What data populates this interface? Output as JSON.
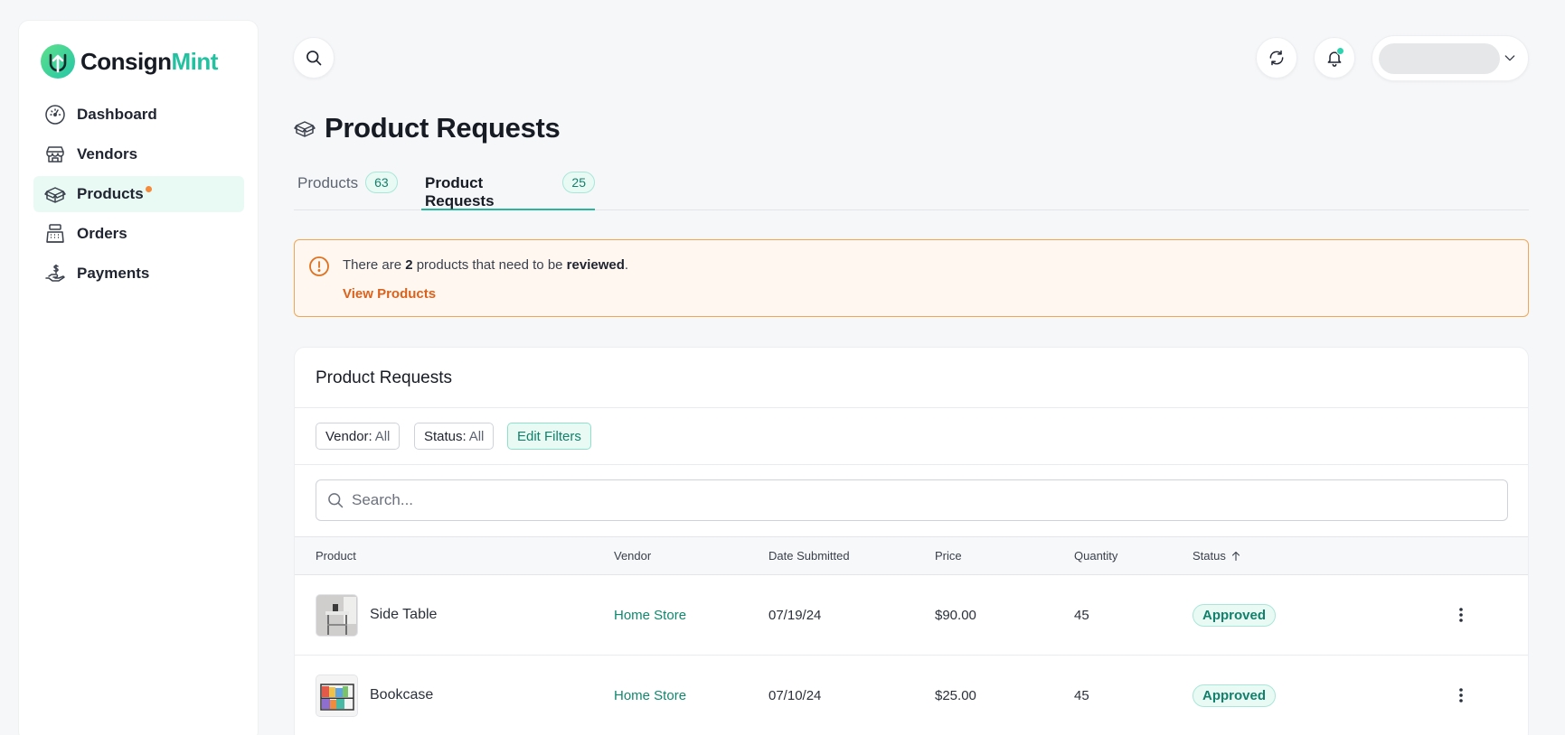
{
  "brand": {
    "name_dark": "Consign",
    "name_accent": "Mint",
    "accent_color": "#22c1a0"
  },
  "sidebar": {
    "items": [
      {
        "label": "Dashboard",
        "icon": "dashboard-icon",
        "active": false
      },
      {
        "label": "Vendors",
        "icon": "store-icon",
        "active": false
      },
      {
        "label": "Products",
        "icon": "box-icon",
        "active": true,
        "has_dot": true
      },
      {
        "label": "Orders",
        "icon": "register-icon",
        "active": false
      },
      {
        "label": "Payments",
        "icon": "payment-hand-icon",
        "active": false
      }
    ]
  },
  "header": {
    "title": "Product Requests",
    "title_icon": "box-icon"
  },
  "tabs": [
    {
      "label": "Products",
      "count": "63",
      "active": false
    },
    {
      "label": "Product Requests",
      "count": "25",
      "active": true
    }
  ],
  "alert": {
    "text_1": "There are ",
    "count": "2",
    "text_2": " products that need to be ",
    "emphasis": "reviewed",
    "text_3": ".",
    "link": "View Products"
  },
  "card": {
    "title": "Product Requests",
    "filters": {
      "vendor_key": "Vendor:",
      "vendor_value": "All",
      "status_key": "Status:",
      "status_value": "All",
      "edit_label": "Edit Filters"
    },
    "search_placeholder": "Search...",
    "columns": [
      "Product",
      "Vendor",
      "Date Submitted",
      "Price",
      "Quantity",
      "Status"
    ],
    "sort_column": "Status",
    "rows": [
      {
        "product": "Side Table",
        "vendor": "Home Store",
        "date": "07/19/24",
        "price": "$90.00",
        "quantity": "45",
        "status": "Approved"
      },
      {
        "product": "Bookcase",
        "vendor": "Home Store",
        "date": "07/10/24",
        "price": "$25.00",
        "quantity": "45",
        "status": "Approved"
      }
    ]
  }
}
